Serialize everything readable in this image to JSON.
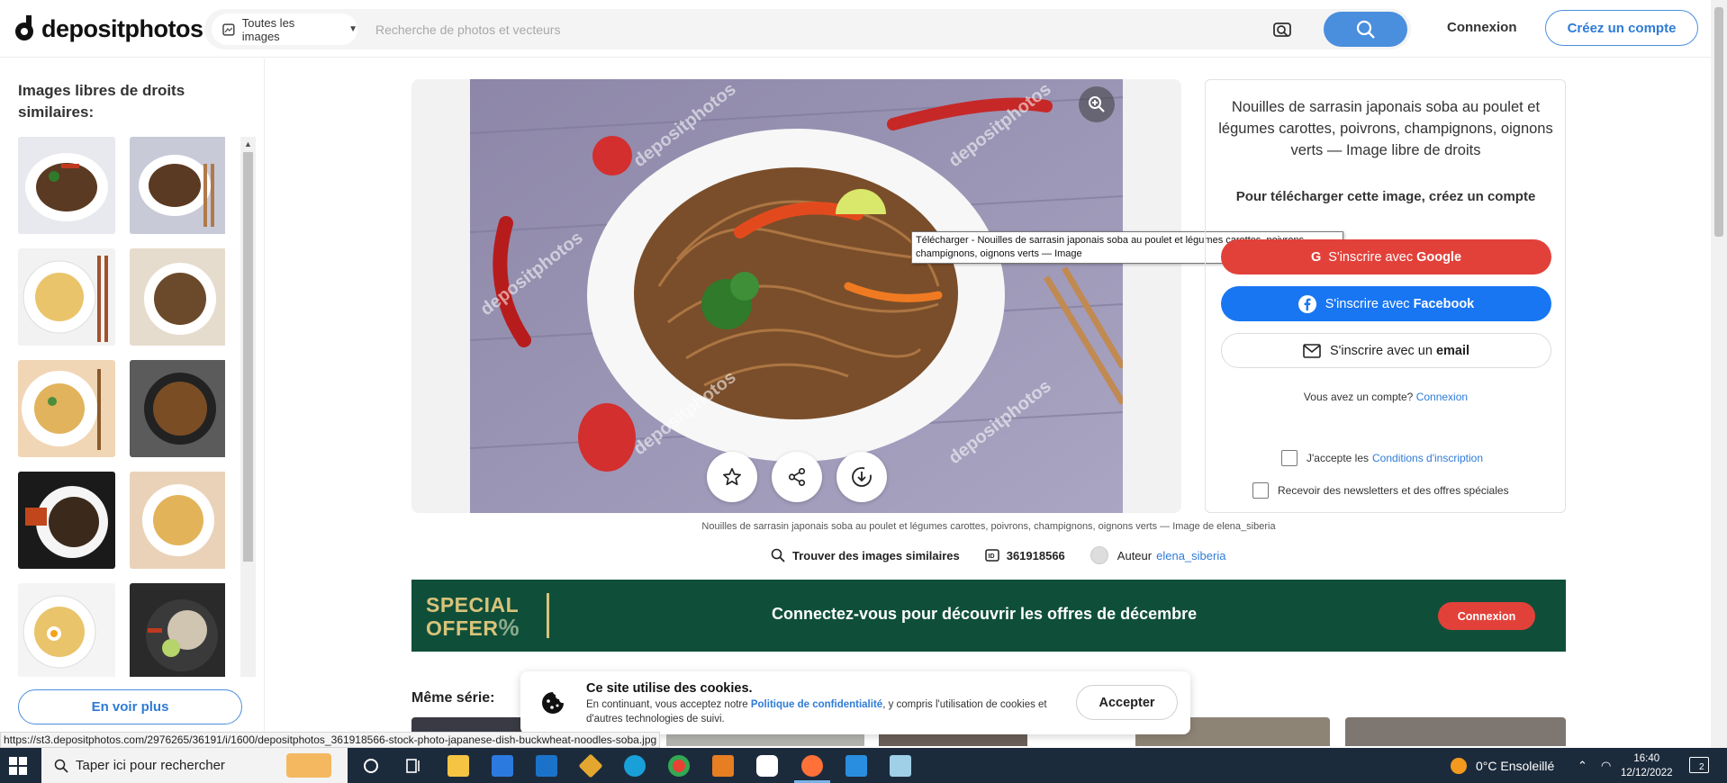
{
  "header": {
    "logo_text": "depositphotos",
    "filter_label": "Toutes les images",
    "search_placeholder": "Recherche de photos et vecteurs",
    "login_label": "Connexion",
    "create_account_label": "Créez un compte",
    "accent_color": "#4a8ede"
  },
  "sidebar": {
    "title": "Images libres de droits similaires:",
    "see_more_label": "En voir plus",
    "thumbnails": [
      {
        "name": "soba-noodles-bowl-1"
      },
      {
        "name": "soba-noodles-bowl-2"
      },
      {
        "name": "udon-noodles-chopsticks"
      },
      {
        "name": "noodles-plate-top"
      },
      {
        "name": "chow-mein-white-plate"
      },
      {
        "name": "noodles-wok-dark"
      },
      {
        "name": "beef-noodles-chopsticks"
      },
      {
        "name": "egg-noodles-plate"
      },
      {
        "name": "ramen-egg-bowl"
      },
      {
        "name": "rice-bowl-lime"
      }
    ]
  },
  "main": {
    "image_alt": "Nouilles de sarrasin japonais soba au poulet et légumes carottes, poivrons, champignons, oignons verts — Image libre de droits",
    "watermark": "depositphotos",
    "tooltip": "Télécharger - Nouilles de sarrasin japonais soba au poulet et légumes carottes, poivrons, champignons, oignons verts — Image",
    "caption": "Nouilles de sarrasin japonais soba au poulet et légumes carottes, poivrons, champignons, oignons verts — Image de elena_siberia",
    "find_similar_label": "Trouver des images similaires",
    "image_id": "361918566",
    "author_label": "Auteur",
    "author_name": "elena_siberia"
  },
  "panel": {
    "title": "Nouilles de sarrasin japonais soba au poulet et légumes carottes, poivrons, champignons, oignons verts — Image libre de droits",
    "subtitle": "Pour télécharger cette image, créez un compte",
    "google_prefix": "S'inscrire avec",
    "google_brand": "Google",
    "facebook_prefix": "S'inscrire avec",
    "facebook_brand": "Facebook",
    "email_prefix": "S'inscrire avec un",
    "email_brand": "email",
    "have_account": "Vous avez un compte?",
    "have_account_link": "Connexion",
    "terms_prefix": "J'accepte les",
    "terms_link": "Conditions d'inscription",
    "newsletter": "Recevoir des newsletters et des offres spéciales"
  },
  "banner": {
    "logo_line1": "SPECIAL",
    "logo_line2": "OFFER",
    "logo_mark": "%",
    "text": "Connectez-vous pour découvrir les offres de décembre",
    "button_label": "Connexion",
    "bg_color": "#0f4f3a"
  },
  "series": {
    "title": "Même série:"
  },
  "cookie": {
    "title": "Ce site utilise des cookies.",
    "text_before": "En continuant, vous acceptez notre",
    "link": "Politique de confidentialité",
    "text_after": ", y compris l'utilisation de cookies et d'autres technologies de suivi.",
    "accept_label": "Accepter"
  },
  "status_url": "https://st3.depositphotos.com/2976265/36191/i/1600/depositphotos_361918566-stock-photo-japanese-dish-buckwheat-noodles-soba.jpg",
  "taskbar": {
    "search_placeholder": "Taper ici pour rechercher",
    "weather": "0°C  Ensoleillé",
    "time": "16:40",
    "date": "12/12/2022",
    "notifications": "2"
  }
}
